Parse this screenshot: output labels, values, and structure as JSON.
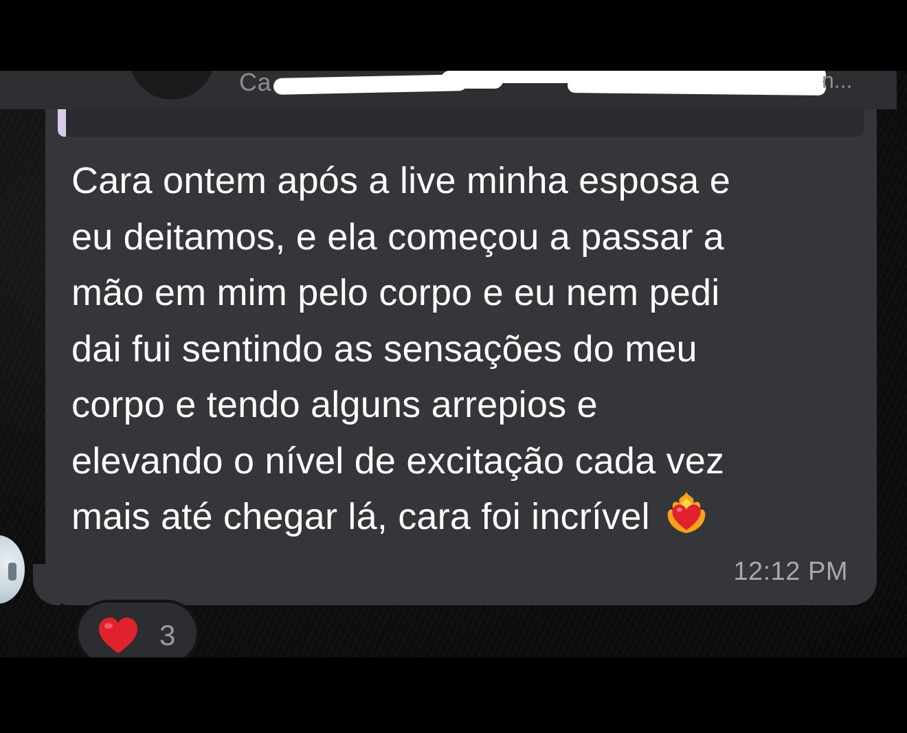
{
  "header": {
    "sender_name_fragment": "Ca",
    "trailing_fragment": "n..."
  },
  "message": {
    "lines": [
      "Cara ontem após a live minha esposa e",
      "eu deitamos, e ela começou a passar a",
      "mão em mim pelo corpo e eu nem pedi",
      "dai fui sentindo as sensações do meu",
      "corpo e tendo alguns arrepios e",
      "elevando o nível de excitação cada vez",
      "mais até chegar lá, cara foi incrível"
    ],
    "emoji": "heart-on-fire-icon",
    "timestamp": "12:12 PM"
  },
  "reaction": {
    "emoji": "red-heart-icon",
    "count": "3"
  },
  "colors": {
    "bubble": "#353639",
    "header": "#2e2f33",
    "text": "#ffffff",
    "timestamp": "#a8a9ad",
    "quote_accent": "#d9cbe8",
    "heart_red": "#e0212e"
  }
}
